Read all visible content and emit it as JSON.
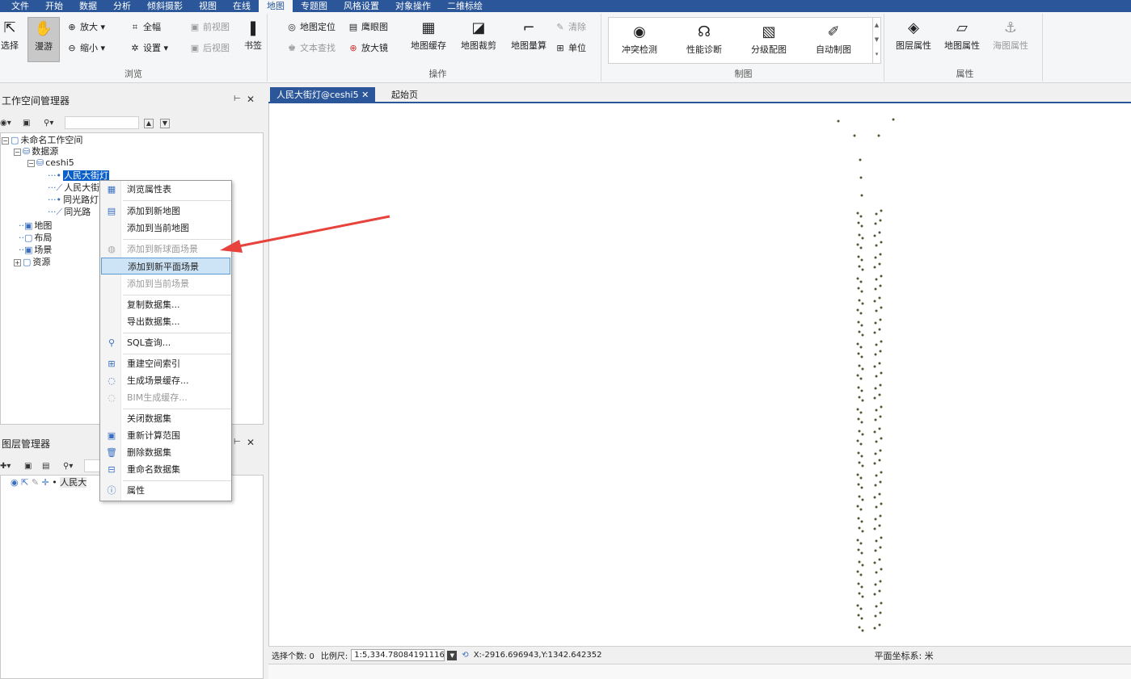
{
  "menubar": [
    "文件",
    "开始",
    "数据",
    "分析",
    "倾斜摄影",
    "视图",
    "在线",
    "地图",
    "专题图",
    "风格设置",
    "对象操作",
    "二维标绘"
  ],
  "menubar_active": 7,
  "ribbon": {
    "browse": {
      "title": "浏览",
      "select": "选择",
      "pan": "漫游",
      "zoom_in": "放大",
      "zoom_out": "缩小",
      "full_extent": "全幅",
      "settings": "设置",
      "prev_view": "前视图",
      "next_view": "后视图",
      "bookmark": "书签"
    },
    "ops": {
      "title": "操作",
      "locate": "地图定位",
      "eagle_eye": "鹰眼图",
      "text_search": "文本查找",
      "magnifier": "放大镜",
      "map_cache": "地图缓存",
      "map_clip": "地图裁剪",
      "map_measure": "地图量算",
      "clear": "清除",
      "unit": "单位"
    },
    "cartography": {
      "title": "制图",
      "conflict": "冲突检测",
      "perf": "性能诊断",
      "graded": "分级配图",
      "auto_map": "自动制图"
    },
    "props": {
      "title": "属性",
      "layer_props": "图层属性",
      "map_props": "地图属性",
      "chart_props": "海图属性"
    }
  },
  "workspace": {
    "title": "工作空间管理器",
    "root": "未命名工作空间",
    "datasources": "数据源",
    "ds_name": "ceshi5",
    "datasets": [
      "人民大街灯",
      "人民大街",
      "同光路灯",
      "同光路"
    ],
    "maps": "地图",
    "layouts": "布局",
    "scenes": "场景",
    "resources": "资源"
  },
  "layer_manager": {
    "title": "图层管理器",
    "layer": "人民大"
  },
  "tabs": [
    "人民大街灯@ceshi5",
    "起始页"
  ],
  "context_menu": {
    "items": [
      "浏览属性表",
      "添加到新地图",
      "添加到当前地图",
      "添加到新球面场景",
      "添加到新平面场景",
      "添加到当前场景",
      "复制数据集...",
      "导出数据集...",
      "SQL查询...",
      "重建空间索引",
      "生成场景缓存...",
      "BIM生成缓存...",
      "关闭数据集",
      "重新计算范围",
      "删除数据集",
      "重命名数据集",
      "属性"
    ],
    "highlighted": 4
  },
  "status": {
    "select_label": "选择个数: 0",
    "scale_label": "比例尺:",
    "scale_value": "1:5,334.78084191116",
    "coords": "X:-2916.696943,Y:1342.642352",
    "crs": "平面坐标系: 米"
  },
  "colors": {
    "accent": "#2b579a",
    "arrow": "#e8423c",
    "point": "#555533"
  }
}
